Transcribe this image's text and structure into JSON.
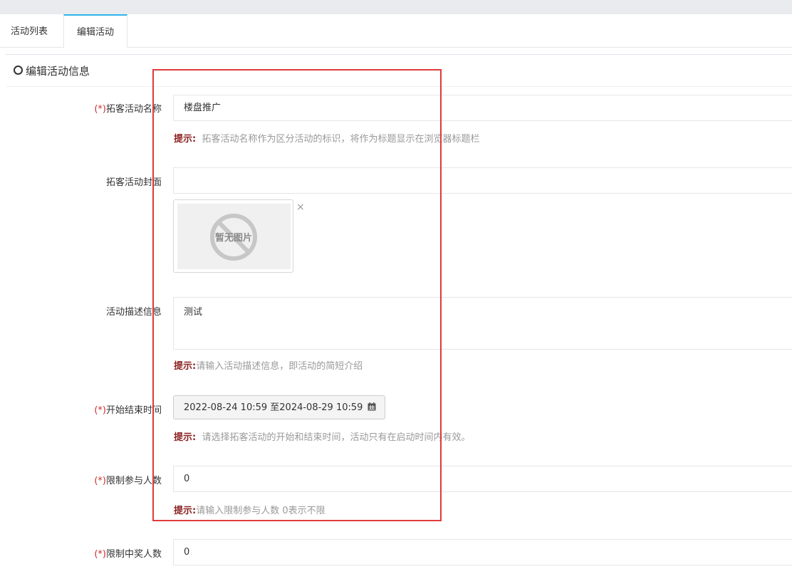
{
  "tabs": [
    "活动列表",
    "编辑活动"
  ],
  "panel": {
    "title": "编辑活动信息"
  },
  "required_mark": "(*)",
  "form": {
    "name": {
      "label": "拓客活动名称",
      "value": "楼盘推广",
      "hint_prefix": "提示:",
      "hint": "拓客活动名称作为区分活动的标识，将作为标题显示在浏览器标题栏"
    },
    "cover": {
      "label": "拓客活动封面",
      "value": "",
      "placeholder_image_text": "暂无图片",
      "remove_glyph": "×"
    },
    "desc": {
      "label": "活动描述信息",
      "value": "测试",
      "hint_prefix": "提示:",
      "hint": "请输入活动描述信息，即活动的简短介绍"
    },
    "time": {
      "label": "开始结束时间",
      "value": "2022-08-24 10:59 至2024-08-29 10:59",
      "hint_prefix": "提示:",
      "hint": "请选择拓客活动的开始和结束时间，活动只有在启动时间内有效。"
    },
    "limit_participants": {
      "label": "限制参与人数",
      "value": "0",
      "hint_prefix": "提示:",
      "hint": "请输入限制参与人数 0表示不限"
    },
    "limit_winners": {
      "label": "限制中奖人数",
      "value": "0"
    }
  },
  "colors": {
    "accent": "#2fb4ea",
    "required": "#c9302c",
    "hint_prefix": "#8b1f1f",
    "annotation_box": "#e03a3a"
  }
}
